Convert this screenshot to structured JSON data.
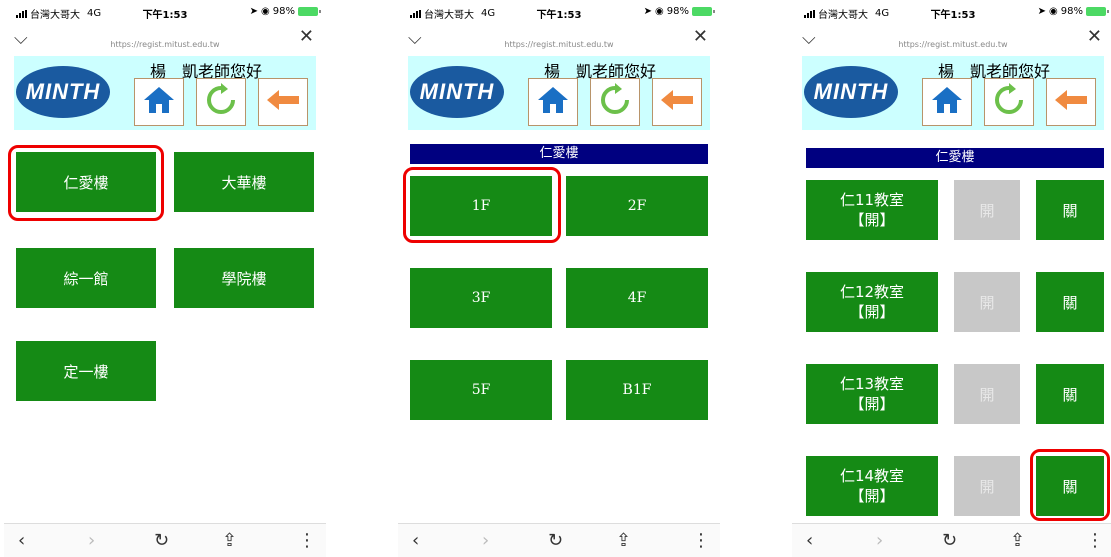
{
  "status": {
    "carrier": "台灣大哥大",
    "network": "4G",
    "time": "下午1:53",
    "battery": "98%"
  },
  "browser": {
    "url": "https://regist.mitust.edu.tw"
  },
  "header": {
    "logo": "MINTH",
    "greeting": "楊　凱老師您好"
  },
  "screen1": {
    "buildings": [
      "仁愛樓",
      "大華樓",
      "綜一館",
      "學院樓",
      "定一樓"
    ]
  },
  "screen2": {
    "section": "仁愛樓",
    "floors": [
      "1F",
      "2F",
      "3F",
      "4F",
      "5F",
      "B1F"
    ]
  },
  "screen3": {
    "section": "仁愛樓",
    "rooms": [
      {
        "name": "仁11教室",
        "state": "【開】",
        "open_label": "開",
        "close_label": "關"
      },
      {
        "name": "仁12教室",
        "state": "【開】",
        "open_label": "開",
        "close_label": "關"
      },
      {
        "name": "仁13教室",
        "state": "【開】",
        "open_label": "開",
        "close_label": "關"
      },
      {
        "name": "仁14教室",
        "state": "【開】",
        "open_label": "開",
        "close_label": "關"
      }
    ]
  },
  "colors": {
    "tile": "#158a15",
    "bar": "#000080",
    "header_bg": "#ccffff",
    "highlight": "#e00000"
  },
  "icons": {
    "home": "home-icon",
    "refresh": "refresh-icon",
    "back": "back-arrow-icon"
  }
}
